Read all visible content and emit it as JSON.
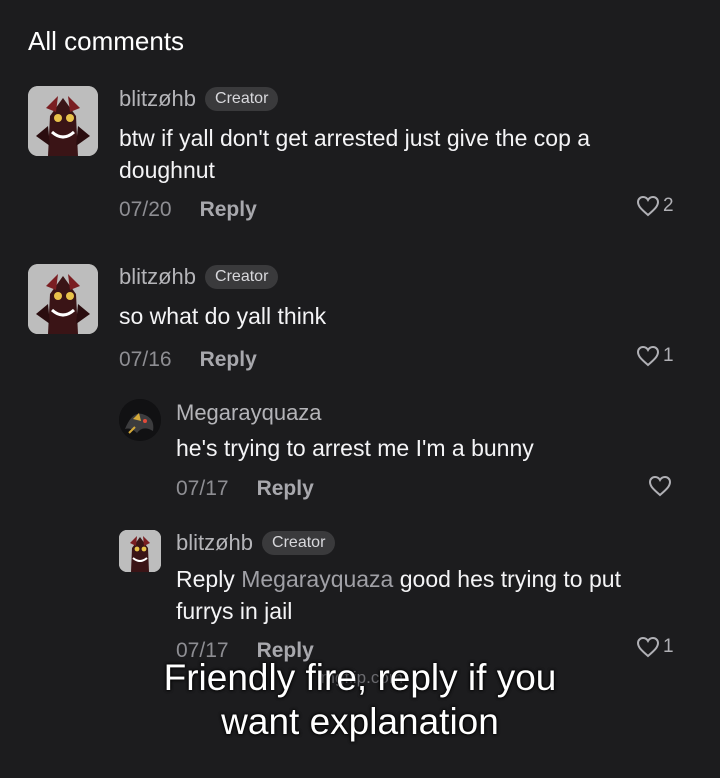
{
  "header": {
    "title": "All comments"
  },
  "comments": [
    {
      "username": "blitzøhb",
      "badge": "Creator",
      "text": "btw if yall don't get arrested just give the cop a doughnut",
      "date": "07/20",
      "reply_label": "Reply",
      "likes": "2"
    },
    {
      "username": "blitzøhb",
      "badge": "Creator",
      "text": "so what do yall think",
      "date": "07/16",
      "reply_label": "Reply",
      "likes": "1"
    }
  ],
  "replies": [
    {
      "username": "Megarayquaza",
      "text": "he's trying to arrest me I'm a bunny",
      "date": "07/17",
      "reply_label": "Reply",
      "likes": ""
    },
    {
      "username": "blitzøhb",
      "badge": "Creator",
      "reply_prefix": "Reply",
      "mention": "Megarayquaza",
      "text": "good hes trying to put furrys in jail",
      "date": "07/17",
      "reply_label": "Reply",
      "likes": "1"
    }
  ],
  "watermark": "imgflip.com",
  "caption": "Friendly fire, reply if you want explanation",
  "colors": {
    "background": "#1c1c1e",
    "username": "#b4b4b8",
    "badge_bg": "#3a3a3c",
    "muted": "#8e8e93"
  },
  "icons": [
    "heart-icon",
    "avatar-blitzo",
    "avatar-megarayquaza"
  ]
}
